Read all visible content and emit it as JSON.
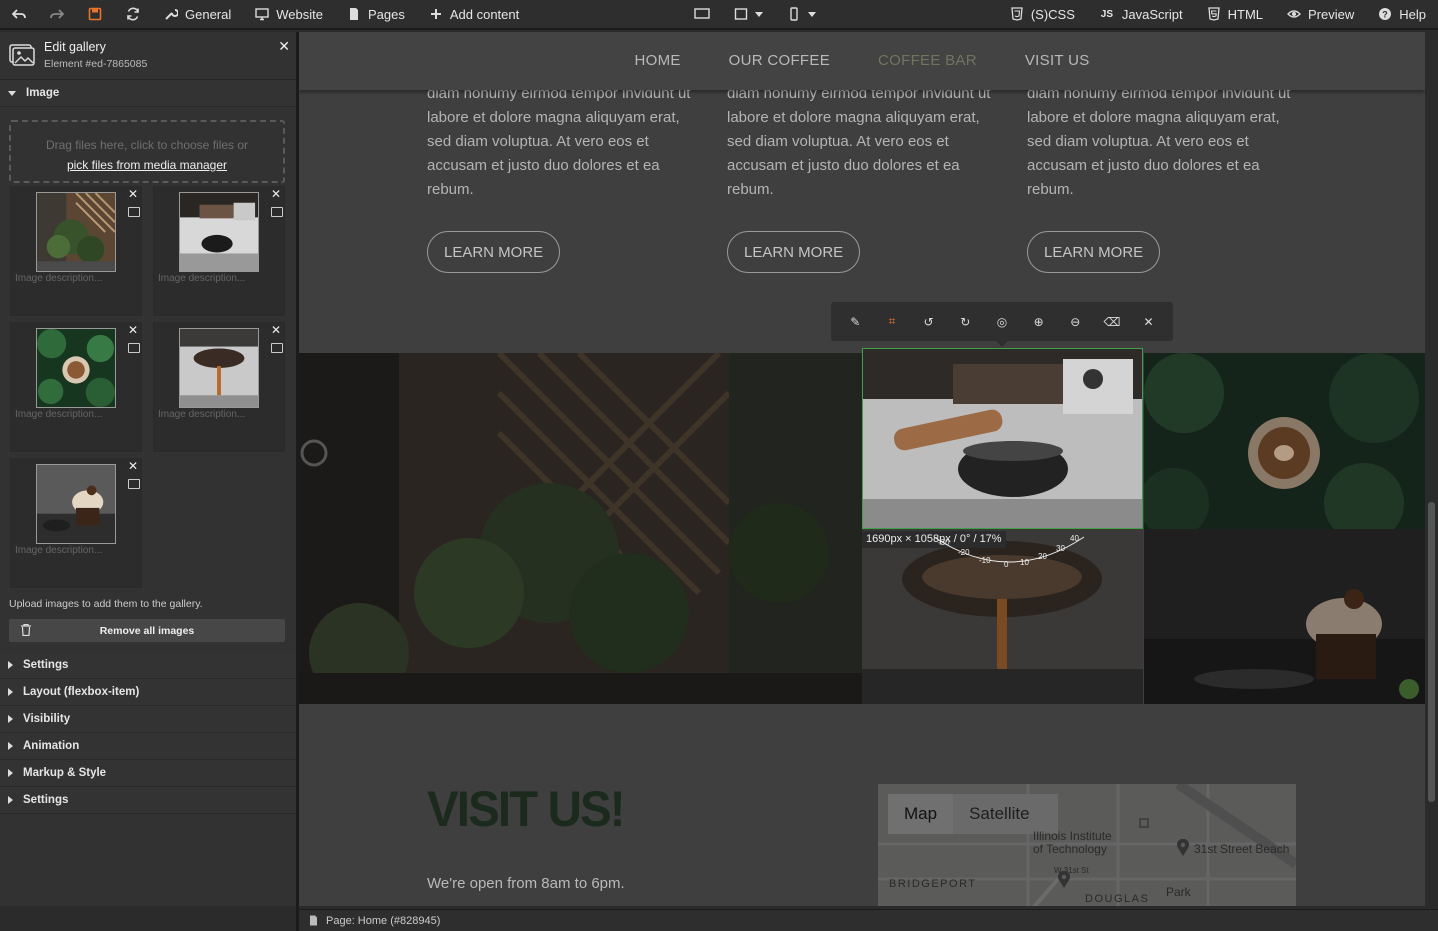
{
  "toolbar": {
    "general": "General",
    "website": "Website",
    "pages": "Pages",
    "add_content": "Add content",
    "scss": "(S)CSS",
    "javascript": "JavaScript",
    "html": "HTML",
    "preview": "Preview",
    "help": "Help"
  },
  "panel": {
    "title": "Edit gallery",
    "element_id": "Element #ed-7865085",
    "image_section": "Image",
    "dropzone_text": "Drag files here, click to choose files or",
    "dropzone_link": "pick files from media manager",
    "description_placeholder": "Image description...",
    "upload_note": "Upload images to add them to the gallery.",
    "remove_all": "Remove all images",
    "sections": [
      "Settings",
      "Layout (flexbox-item)",
      "Visibility",
      "Animation",
      "Markup & Style",
      "Settings"
    ]
  },
  "site": {
    "nav": [
      "HOME",
      "OUR COFFEE",
      "COFFEE BAR",
      "VISIT US"
    ],
    "nav_active_index": 2,
    "column_text": "diam nonumy eirmod tempor invidunt ut labore et dolore magna aliquyam erat, sed diam voluptua. At vero eos et accusam et justo duo dolores et ea rebum.",
    "learn_more": "LEARN MORE",
    "visit_title": "VISIT US!",
    "visit_hours": "We're open from 8am to 6pm.",
    "map": {
      "tab_map": "Map",
      "tab_satellite": "Satellite",
      "labels": [
        "Illinois Institute of Technology",
        "31st Street Beach",
        "BRIDGEPORT",
        "W 31st St",
        "DOUGLAS",
        "Park"
      ]
    }
  },
  "image_editor": {
    "dimensions": "1690px × 1058px / 0° / 17%",
    "tools": [
      "edit-icon",
      "crop-icon",
      "rotate-left-icon",
      "rotate-right-icon",
      "focus-icon",
      "zoom-in-icon",
      "zoom-out-icon",
      "eraser-icon",
      "close-icon"
    ]
  },
  "status": {
    "page": "Page: Home (#828945)"
  },
  "colors": {
    "accent_orange": "#e8742a",
    "selection_green": "#3fa24a"
  }
}
